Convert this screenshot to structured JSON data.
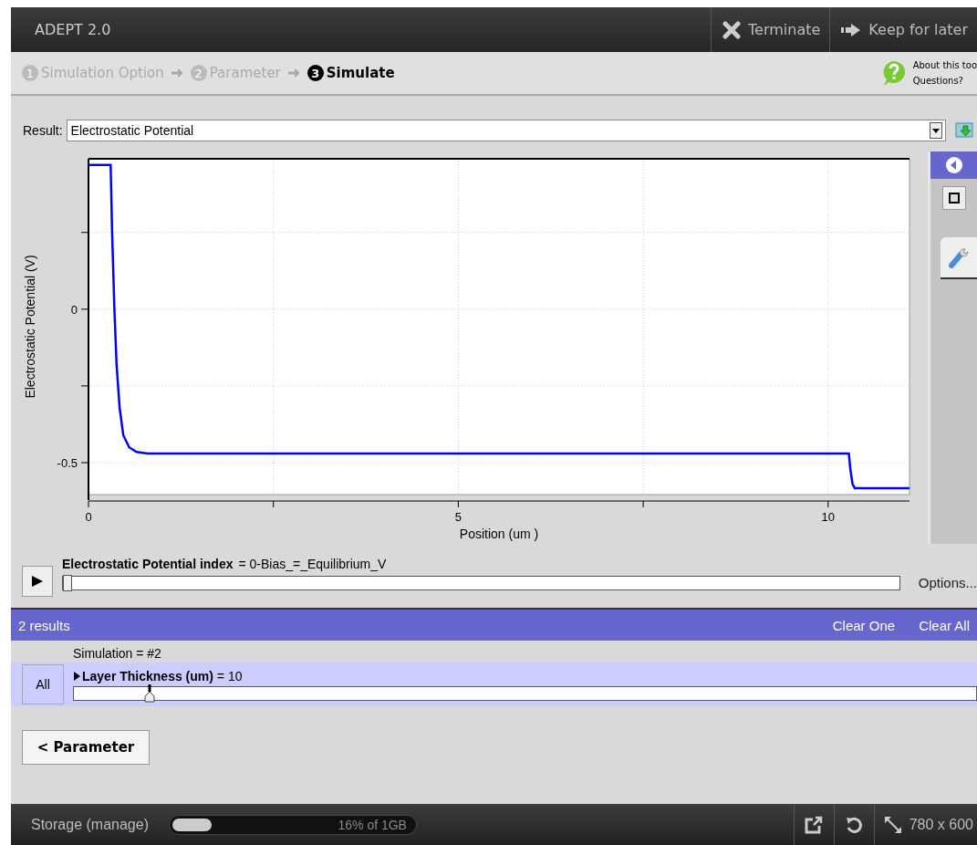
{
  "window": {
    "title": "ADEPT 2.0"
  },
  "header_buttons": [
    {
      "label": "Terminate",
      "kind": "terminate"
    },
    {
      "label": "Keep for later",
      "kind": "keep"
    }
  ],
  "steps": [
    {
      "number": "1",
      "label": "Simulation Option",
      "selected": false
    },
    {
      "number": "2",
      "label": "Parameter",
      "selected": false
    },
    {
      "number": "3",
      "label": "Simulate",
      "selected": true
    }
  ],
  "help": {
    "line_1": "About this too",
    "line_2": "Questions?"
  },
  "result": {
    "label": "Result:",
    "value": "Electrostatic Potential"
  },
  "chart": {
    "chart_data": {
      "type": "line",
      "xlabel": "Position (um )",
      "ylabel": "Electrostatic Potential (V)",
      "xlim": [
        0,
        11.1
      ],
      "ylim": [
        -0.604,
        0.49
      ],
      "xticks": [
        0,
        5,
        10
      ],
      "yticks": [
        -0.5,
        0
      ],
      "x": [
        0,
        0.3,
        0.32,
        0.35,
        0.38,
        0.42,
        0.47,
        0.55,
        0.65,
        0.8,
        10.28,
        10.3,
        10.33,
        10.36,
        11.1
      ],
      "grid": true,
      "series": [
        {
          "color": "#0000ff",
          "values": [
            0.47,
            0.47,
            0.25,
            0.0,
            -0.18,
            -0.32,
            -0.41,
            -0.45,
            -0.465,
            -0.47,
            -0.47,
            -0.52,
            -0.57,
            -0.583,
            -0.583
          ]
        }
      ]
    }
  },
  "index_slider": {
    "name": "Electrostatic Potential index",
    "value": "= 0-Bias_=_Equilibrium_V",
    "level": 0,
    "options": "Options..."
  },
  "results_bar": {
    "count": "2 results",
    "actions": [
      "Clear One",
      "Clear All"
    ]
  },
  "simulation": {
    "label": "Simulation = #2",
    "all_button": "All",
    "parameter": {
      "name": "Layer Thickness (um)",
      "value": "= 10",
      "level": 0.084
    }
  },
  "back_button": "< Parameter",
  "status_bar": {
    "storage": "Storage (manage)",
    "usage": "16% of 1GB",
    "level": 0.16,
    "size": "780 x 600"
  }
}
